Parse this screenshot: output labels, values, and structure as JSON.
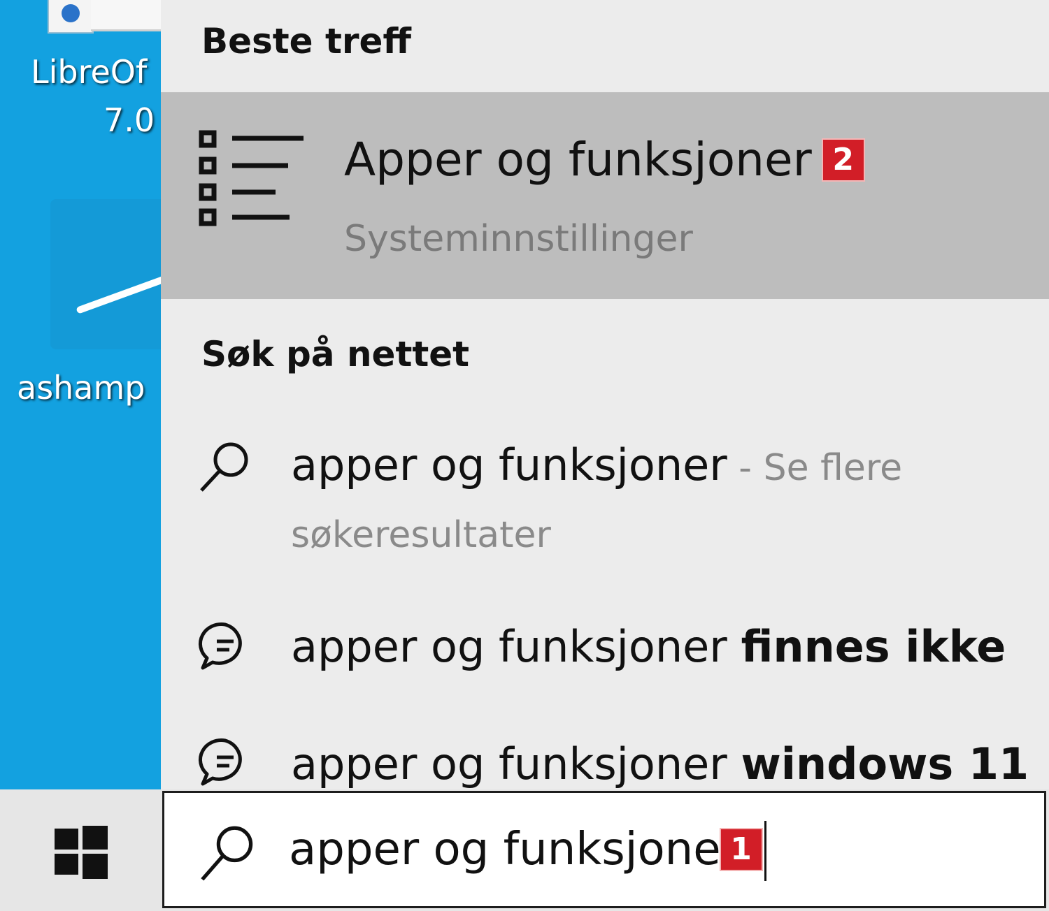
{
  "desktop": {
    "icon1_label_line1": "LibreOf",
    "icon1_label_line2": "7.0",
    "icon2_label": "ashamp"
  },
  "search_panel": {
    "best_match_heading": "Beste treff",
    "best_match": {
      "title": "Apper og funksjoner",
      "subtitle": "Systeminnstillinger",
      "icon": "list-icon",
      "badge": "2"
    },
    "web_heading": "Søk på nettet",
    "web_results": [
      {
        "icon": "search-icon",
        "query": "apper og funksjoner",
        "suffix": " - Se flere",
        "suffix2": "søkeresultater"
      },
      {
        "icon": "chat-bubble-icon",
        "query": "apper og funksjoner ",
        "suggestion": "finnes ikke"
      },
      {
        "icon": "chat-bubble-icon",
        "query": "apper og funksjoner ",
        "suggestion": "windows 11"
      }
    ]
  },
  "taskbar": {
    "start_icon": "windows-logo-icon",
    "search": {
      "icon": "search-icon",
      "value": "apper og funksjone",
      "badge": "1"
    }
  },
  "colors": {
    "desktop": "#13a1e0",
    "panel": "#ececec",
    "selected": "#bdbdbd",
    "badge": "#d21e27"
  }
}
